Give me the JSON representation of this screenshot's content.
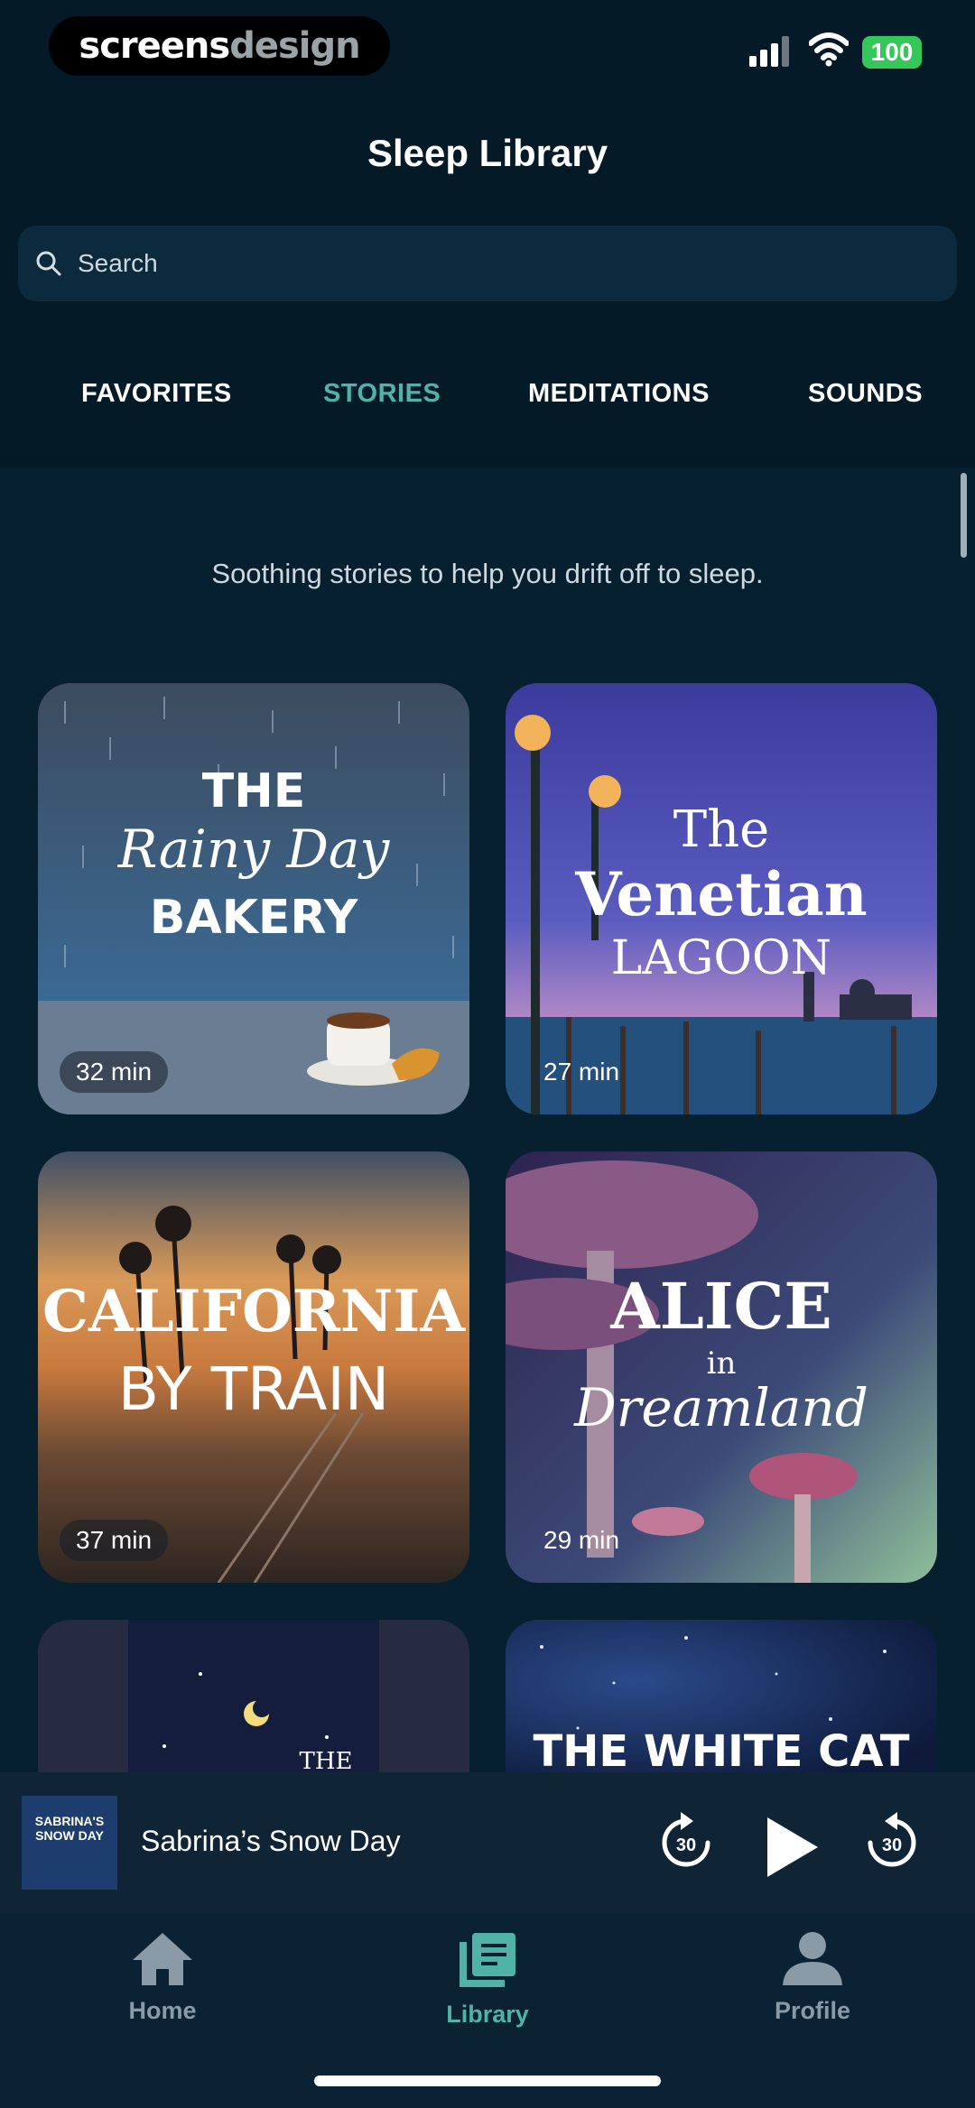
{
  "status_bar": {
    "brand_part1": "screens",
    "brand_part2": "design",
    "battery": "100"
  },
  "header": {
    "title": "Sleep Library",
    "search_placeholder": "Search"
  },
  "tabs": [
    {
      "label": "FAVORITES",
      "active": false
    },
    {
      "label": "STORIES",
      "active": true
    },
    {
      "label": "MEDITATIONS",
      "active": false
    },
    {
      "label": "SOUNDS",
      "active": false
    }
  ],
  "intro": "Soothing stories to help you drift off to sleep.",
  "stories": [
    {
      "title_lines": [
        "THE",
        "Rainy Day",
        "BAKERY"
      ],
      "duration": "32 min"
    },
    {
      "title_lines": [
        "The",
        "Venetian",
        "LAGOON"
      ],
      "duration": "27 min"
    },
    {
      "title_lines": [
        "CALIFORNIA",
        "BY TRAIN"
      ],
      "duration": "37 min"
    },
    {
      "title_lines": [
        "ALICE",
        "in",
        "Dreamland"
      ],
      "duration": "29 min"
    },
    {
      "title_lines": [
        "THE"
      ]
    },
    {
      "title_lines": [
        "THE WHITE CAT"
      ]
    }
  ],
  "player": {
    "cover_text": "SABRINA'S SNOW DAY",
    "now_playing": "Sabrina’s Snow Day",
    "skip_back_seconds": "30",
    "skip_forward_seconds": "30"
  },
  "nav": [
    {
      "label": "Home",
      "icon": "home-icon",
      "active": false
    },
    {
      "label": "Library",
      "icon": "library-icon",
      "active": true
    },
    {
      "label": "Profile",
      "icon": "profile-icon",
      "active": false
    }
  ],
  "colors": {
    "accent": "#4fb3a9",
    "background": "#06202f",
    "battery": "#34c759"
  }
}
